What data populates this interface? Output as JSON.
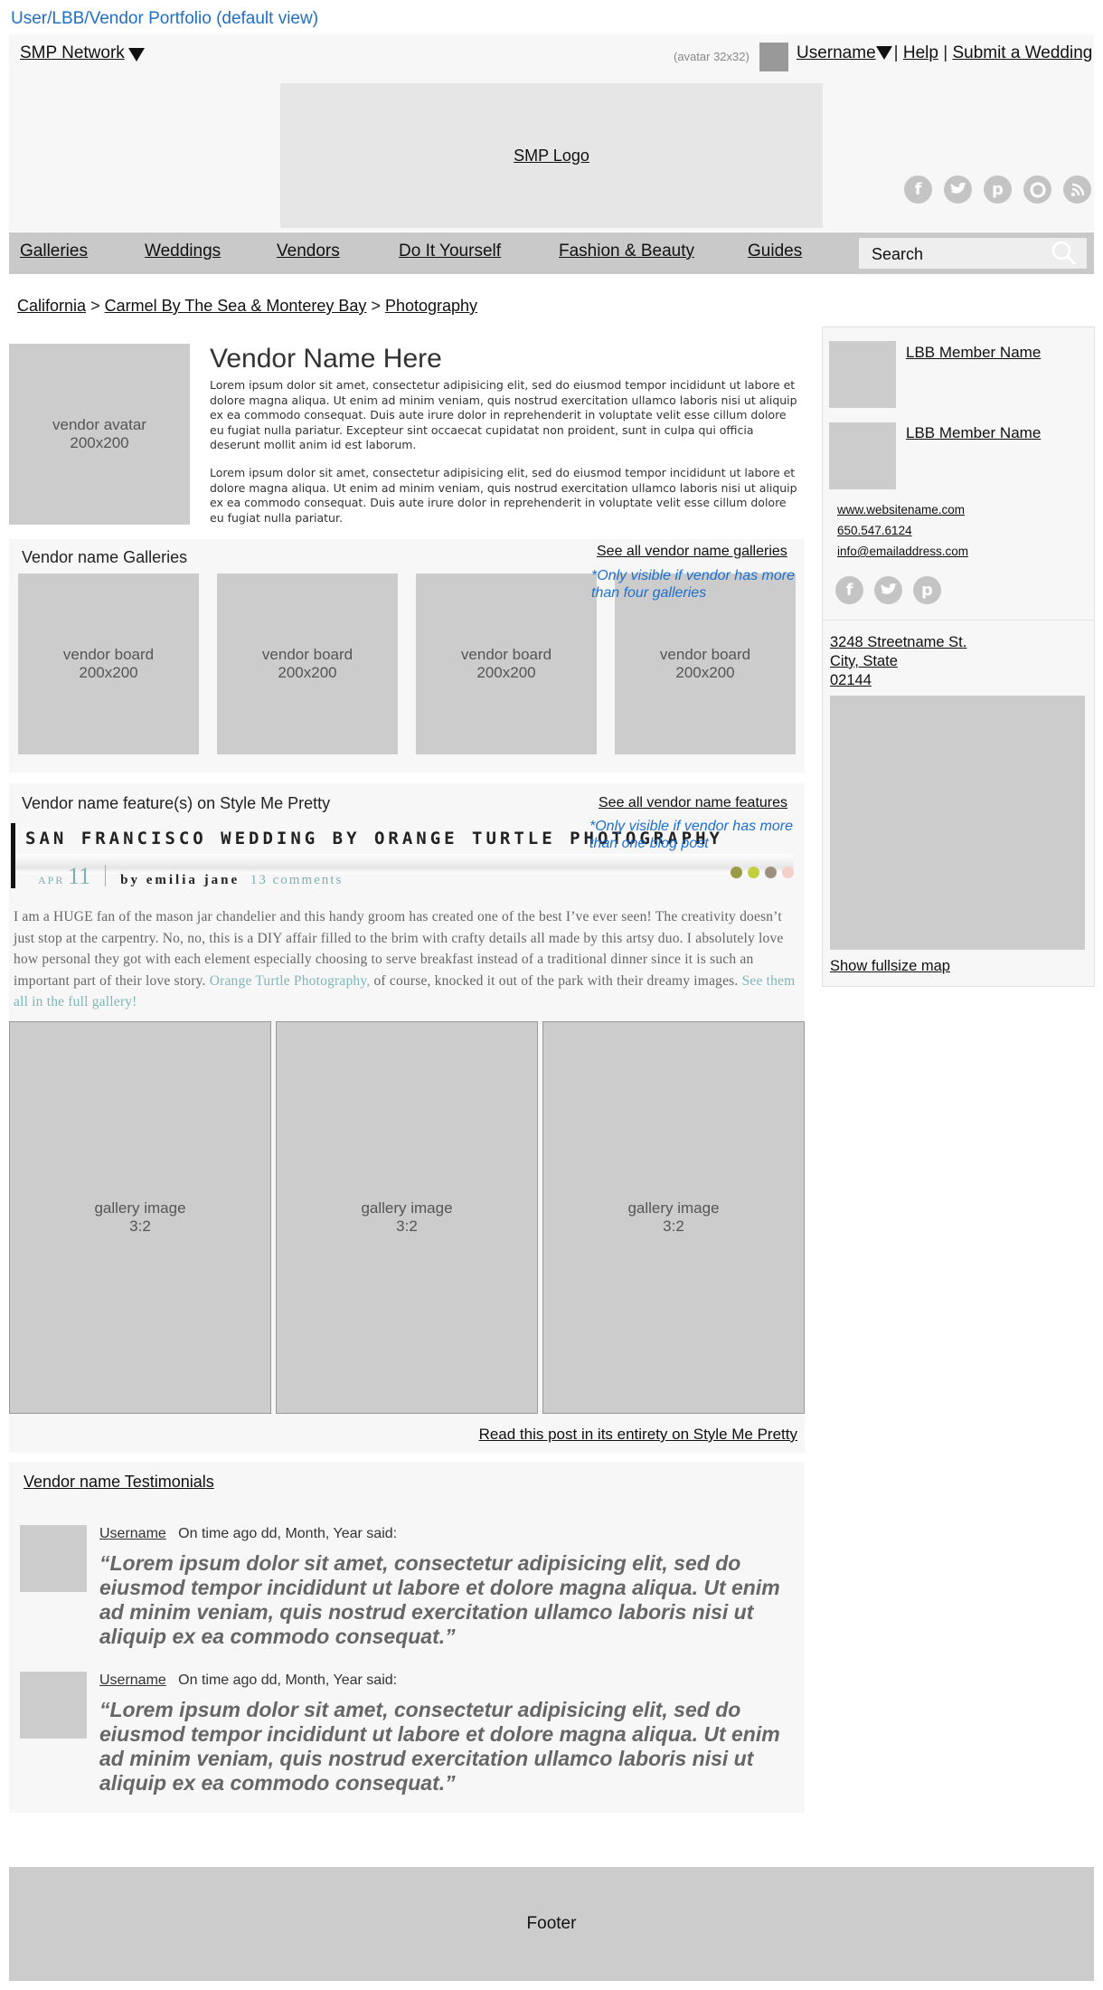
{
  "page_caption": "User/LBB/Vendor Portfolio (default view)",
  "header": {
    "network_label": "SMP Network",
    "avatar_note": "(avatar 32x32)",
    "username": "Username",
    "help": "Help",
    "submit": "Submit a Wedding",
    "separator": "|",
    "logo": "SMP Logo",
    "social_icons": [
      "facebook-icon",
      "twitter-icon",
      "pinterest-icon",
      "instagram-icon",
      "rss-icon"
    ]
  },
  "nav": {
    "items": [
      "Galleries",
      "Weddings",
      "Vendors",
      "Do It Yourself",
      "Fashion & Beauty",
      "Guides"
    ],
    "search_placeholder": "Search"
  },
  "breadcrumb": {
    "items": [
      "California",
      "Carmel By The Sea & Monterey Bay",
      "Photography"
    ],
    "separator": ">"
  },
  "vendor": {
    "avatar_line1": "vendor avatar",
    "avatar_line2": "200x200",
    "name": "Vendor Name Here",
    "bio_1": "Lorem ipsum dolor sit amet, consectetur adipisicing elit, sed do eiusmod tempor incididunt ut labore et dolore magna aliqua. Ut enim ad minim veniam, quis nostrud exercitation ullamco laboris nisi ut aliquip ex ea commodo consequat. Duis aute irure dolor in reprehenderit in voluptate velit esse cillum dolore eu fugiat nulla pariatur. Excepteur sint occaecat cupidatat non proident, sunt in culpa qui officia deserunt mollit anim id est laborum.",
    "bio_2": "Lorem ipsum dolor sit amet, consectetur adipisicing elit, sed do eiusmod tempor incididunt ut labore et dolore magna aliqua. Ut enim ad minim veniam, quis nostrud exercitation ullamco laboris nisi ut aliquip ex ea commodo consequat. Duis aute irure dolor in reprehenderit in voluptate velit esse cillum dolore eu fugiat nulla pariatur."
  },
  "galleries": {
    "title": "Vendor name Galleries",
    "see_all": "See all vendor name galleries",
    "note": "*Only visible if vendor has more than four galleries",
    "board_line1": "vendor board",
    "board_line2": "200x200"
  },
  "features": {
    "title": "Vendor name feature(s) on Style Me Pretty",
    "see_all": "See all vendor name features",
    "note": "*Only visible if vendor has more than one blog post",
    "post_title": "SAN FRANCISCO WEDDING BY ORANGE TURTLE PHOTOGRAPHY",
    "month": "APR",
    "day": "11",
    "byline": "by emilia jane",
    "comments": "13 comments",
    "excerpt_1": "I am a HUGE fan of the mason jar chandelier and this handy groom has created one of the best I’ve ever seen!  The creativity doesn’t just stop at the carpentry.  No, no, this is a DIY affair filled to the brim with crafty details all made by this artsy duo.  I absolutely love how personal they got with each element especially choosing to serve breakfast instead of a traditional dinner since it is such an important part of their love story.",
    "excerpt_link_1": "Orange Turtle Photography,",
    "excerpt_2": "of course, knocked it out of the park with their dreamy images.",
    "excerpt_link_2": "See them all in the full gallery!",
    "dot_colors": [
      "#9a9a48",
      "#c3cf3c",
      "#9e8f7e",
      "#f4cfc8"
    ],
    "gallery_line1": "gallery image",
    "gallery_line2": "3:2",
    "read_more": "Read this post in its entirety on Style Me Pretty"
  },
  "testimonials": {
    "title": "Vendor name Testimonials",
    "items": [
      {
        "username": "Username",
        "meta": "On time ago dd, Month, Year said:",
        "quote": "“Lorem ipsum dolor sit amet, consectetur adipisicing elit, sed do eiusmod tempor incididunt ut labore et dolore magna aliqua. Ut enim ad minim veniam, quis nostrud exercitation ullamco laboris nisi ut aliquip ex ea commodo consequat.”"
      },
      {
        "username": "Username",
        "meta": "On time ago dd, Month, Year said:",
        "quote": "“Lorem ipsum dolor sit amet, consectetur adipisicing elit, sed do eiusmod tempor incididunt ut labore et dolore magna aliqua. Ut enim ad minim veniam, quis nostrud exercitation ullamco laboris nisi ut aliquip ex ea commodo consequat.”"
      }
    ]
  },
  "sidebar": {
    "members": [
      "LBB Member Name",
      "LBB Member Name"
    ],
    "website": "www.websitename.com",
    "phone": "650.547.6124",
    "email": "info@emailaddress.com",
    "social_icons": [
      "facebook-icon",
      "twitter-icon",
      "pinterest-icon"
    ],
    "address_line1": "3248 Streetname St.",
    "address_line2": "City, State",
    "address_line3": "02144",
    "show_map": "Show fullsize map"
  },
  "footer": "Footer"
}
